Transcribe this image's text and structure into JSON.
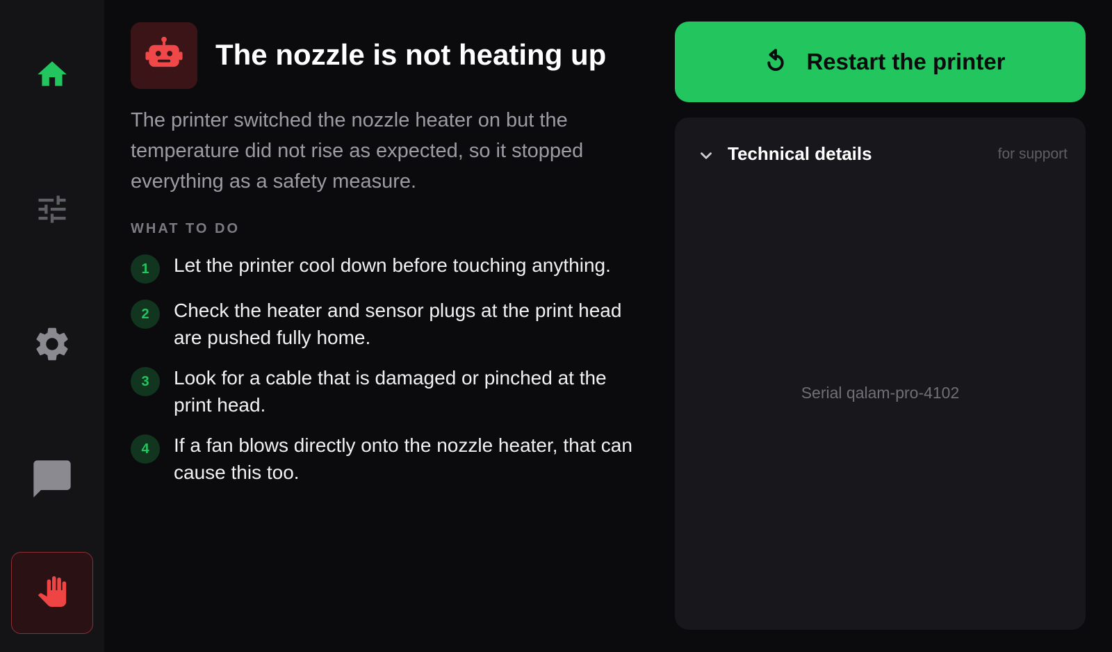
{
  "header": {
    "title": "The nozzle is not heating up",
    "icon": "robot-icon"
  },
  "description": "The printer switched the nozzle heater on but the temperature did not rise as expected, so it stopped everything as a safety measure.",
  "steps": {
    "label": "WHAT TO DO",
    "items": [
      {
        "num": "1",
        "text": "Let the printer cool down before touching anything."
      },
      {
        "num": "2",
        "text": "Check the heater and sensor plugs at the print head are pushed fully home."
      },
      {
        "num": "3",
        "text": "Look for a cable that is damaged or pinched at the print head."
      },
      {
        "num": "4",
        "text": "If a fan blows directly onto the nozzle heater, that can cause this too."
      }
    ]
  },
  "actions": {
    "restart_label": "Restart the printer",
    "restart_icon": "restart-icon"
  },
  "details": {
    "title": "Technical details",
    "hint": "for support",
    "serial": "Serial qalam-pro-4102",
    "expanded": true
  },
  "sidebar": {
    "items": [
      {
        "name": "home",
        "icon": "home-icon",
        "active": true
      },
      {
        "name": "controls",
        "icon": "sliders-icon"
      },
      {
        "name": "settings",
        "icon": "gear-icon"
      },
      {
        "name": "messages",
        "icon": "chat-icon"
      },
      {
        "name": "emergency-stop",
        "icon": "hand-stop-icon"
      }
    ]
  },
  "colors": {
    "accent": "#22c55e",
    "danger": "#ef4444",
    "background": "#0b0b0d",
    "panel": "#18181c",
    "sidebar": "#141417"
  }
}
